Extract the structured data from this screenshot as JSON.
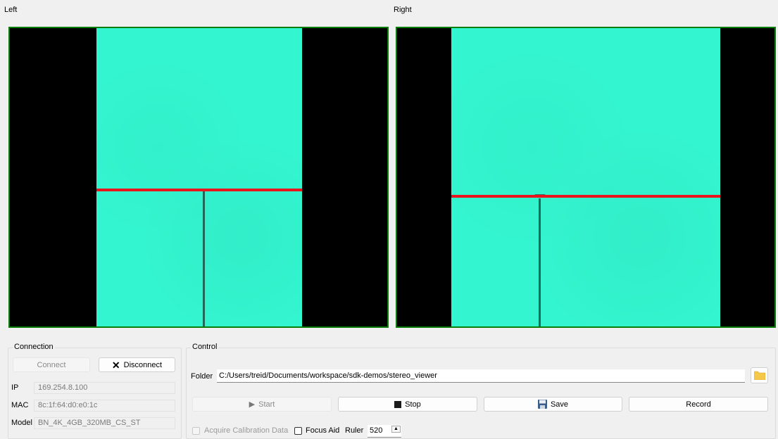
{
  "views": {
    "left": {
      "label": "Left"
    },
    "right": {
      "label": "Right"
    }
  },
  "colors": {
    "frame_border": "#0b7d0b",
    "camera_bg": "#33f5cf",
    "ruler_line": "#e8161c"
  },
  "connection": {
    "title": "Connection",
    "connect_label": "Connect",
    "disconnect_label": "Disconnect",
    "ip_label": "IP",
    "ip_value": "169.254.8.100",
    "mac_label": "MAC",
    "mac_value": "8c:1f:64:d0:e0:1c",
    "model_label": "Model",
    "model_value": "BN_4K_4GB_320MB_CS_ST"
  },
  "control": {
    "title": "Control",
    "folder_label": "Folder",
    "folder_value": "C:/Users/treid/Documents/workspace/sdk-demos/stereo_viewer",
    "start_label": "Start",
    "stop_label": "Stop",
    "save_label": "Save",
    "record_label": "Record",
    "acquire_calibration_label": "Acquire Calibration Data",
    "focus_aid_label": "Focus Aid",
    "ruler_label": "Ruler",
    "ruler_value": "520"
  }
}
